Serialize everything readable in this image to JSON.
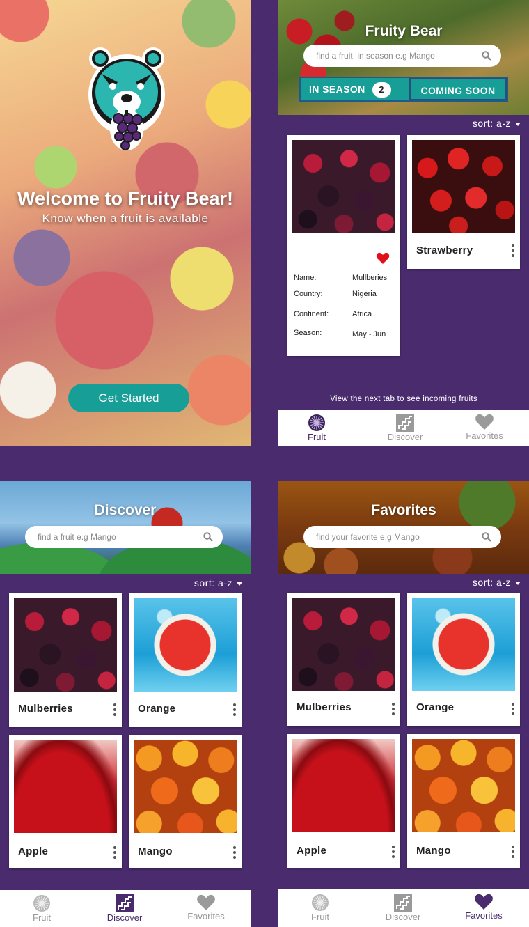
{
  "welcome": {
    "title": "Welcome to Fruity Bear!",
    "subtitle": "Know when a fruit is available",
    "cta": "Get Started"
  },
  "fruit_screen": {
    "title": "Fruity Bear",
    "search_placeholder": "find a fruit  in season e.g Mango",
    "tabs": {
      "in_season": "IN SEASON",
      "in_season_count": "2",
      "coming_soon": "COMING SOON"
    },
    "sort": "sort: a-z",
    "detail_card": {
      "fields": [
        {
          "label": "Name:",
          "value": "Mullberies"
        },
        {
          "label": "Country:",
          "value": "Nigeria"
        },
        {
          "label": "Continent:",
          "value": "Africa"
        },
        {
          "label": "Season:",
          "value": "May - Jun"
        }
      ],
      "favorited": true
    },
    "second_card": {
      "name": "Strawberry"
    },
    "footer_note": "View the next tab to see incoming fruits"
  },
  "discover_screen": {
    "title": "Discover",
    "search_placeholder": "find a fruit e.g Mango",
    "sort": "sort: a-z",
    "cards": [
      "Mulberries",
      "Orange",
      "Apple",
      "Mango"
    ]
  },
  "favorites_screen": {
    "title": "Favorites",
    "search_placeholder": "find your favorite e.g Mango",
    "sort": "sort: a-z",
    "cards": [
      "Mulberries",
      "Orange",
      "Apple",
      "Mango"
    ]
  },
  "nav": {
    "fruit": "Fruit",
    "discover": "Discover",
    "favorites": "Favorites"
  },
  "colors": {
    "purple": "#4a2c6e",
    "teal": "#179e97",
    "heart_red": "#e0101b"
  }
}
